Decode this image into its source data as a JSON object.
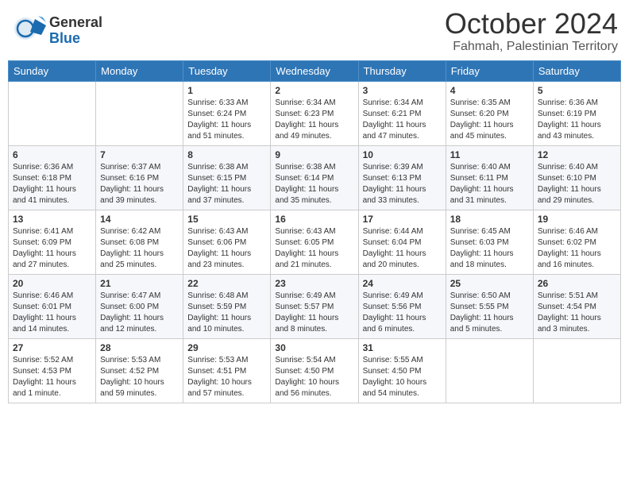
{
  "logo": {
    "general": "General",
    "blue": "Blue"
  },
  "header": {
    "month": "October 2024",
    "subtitle": "Fahmah, Palestinian Territory"
  },
  "days": [
    "Sunday",
    "Monday",
    "Tuesday",
    "Wednesday",
    "Thursday",
    "Friday",
    "Saturday"
  ],
  "weeks": [
    [
      {
        "day": "",
        "sunrise": "",
        "sunset": "",
        "daylight": ""
      },
      {
        "day": "",
        "sunrise": "",
        "sunset": "",
        "daylight": ""
      },
      {
        "day": "1",
        "sunrise": "Sunrise: 6:33 AM",
        "sunset": "Sunset: 6:24 PM",
        "daylight": "Daylight: 11 hours and 51 minutes."
      },
      {
        "day": "2",
        "sunrise": "Sunrise: 6:34 AM",
        "sunset": "Sunset: 6:23 PM",
        "daylight": "Daylight: 11 hours and 49 minutes."
      },
      {
        "day": "3",
        "sunrise": "Sunrise: 6:34 AM",
        "sunset": "Sunset: 6:21 PM",
        "daylight": "Daylight: 11 hours and 47 minutes."
      },
      {
        "day": "4",
        "sunrise": "Sunrise: 6:35 AM",
        "sunset": "Sunset: 6:20 PM",
        "daylight": "Daylight: 11 hours and 45 minutes."
      },
      {
        "day": "5",
        "sunrise": "Sunrise: 6:36 AM",
        "sunset": "Sunset: 6:19 PM",
        "daylight": "Daylight: 11 hours and 43 minutes."
      }
    ],
    [
      {
        "day": "6",
        "sunrise": "Sunrise: 6:36 AM",
        "sunset": "Sunset: 6:18 PM",
        "daylight": "Daylight: 11 hours and 41 minutes."
      },
      {
        "day": "7",
        "sunrise": "Sunrise: 6:37 AM",
        "sunset": "Sunset: 6:16 PM",
        "daylight": "Daylight: 11 hours and 39 minutes."
      },
      {
        "day": "8",
        "sunrise": "Sunrise: 6:38 AM",
        "sunset": "Sunset: 6:15 PM",
        "daylight": "Daylight: 11 hours and 37 minutes."
      },
      {
        "day": "9",
        "sunrise": "Sunrise: 6:38 AM",
        "sunset": "Sunset: 6:14 PM",
        "daylight": "Daylight: 11 hours and 35 minutes."
      },
      {
        "day": "10",
        "sunrise": "Sunrise: 6:39 AM",
        "sunset": "Sunset: 6:13 PM",
        "daylight": "Daylight: 11 hours and 33 minutes."
      },
      {
        "day": "11",
        "sunrise": "Sunrise: 6:40 AM",
        "sunset": "Sunset: 6:11 PM",
        "daylight": "Daylight: 11 hours and 31 minutes."
      },
      {
        "day": "12",
        "sunrise": "Sunrise: 6:40 AM",
        "sunset": "Sunset: 6:10 PM",
        "daylight": "Daylight: 11 hours and 29 minutes."
      }
    ],
    [
      {
        "day": "13",
        "sunrise": "Sunrise: 6:41 AM",
        "sunset": "Sunset: 6:09 PM",
        "daylight": "Daylight: 11 hours and 27 minutes."
      },
      {
        "day": "14",
        "sunrise": "Sunrise: 6:42 AM",
        "sunset": "Sunset: 6:08 PM",
        "daylight": "Daylight: 11 hours and 25 minutes."
      },
      {
        "day": "15",
        "sunrise": "Sunrise: 6:43 AM",
        "sunset": "Sunset: 6:06 PM",
        "daylight": "Daylight: 11 hours and 23 minutes."
      },
      {
        "day": "16",
        "sunrise": "Sunrise: 6:43 AM",
        "sunset": "Sunset: 6:05 PM",
        "daylight": "Daylight: 11 hours and 21 minutes."
      },
      {
        "day": "17",
        "sunrise": "Sunrise: 6:44 AM",
        "sunset": "Sunset: 6:04 PM",
        "daylight": "Daylight: 11 hours and 20 minutes."
      },
      {
        "day": "18",
        "sunrise": "Sunrise: 6:45 AM",
        "sunset": "Sunset: 6:03 PM",
        "daylight": "Daylight: 11 hours and 18 minutes."
      },
      {
        "day": "19",
        "sunrise": "Sunrise: 6:46 AM",
        "sunset": "Sunset: 6:02 PM",
        "daylight": "Daylight: 11 hours and 16 minutes."
      }
    ],
    [
      {
        "day": "20",
        "sunrise": "Sunrise: 6:46 AM",
        "sunset": "Sunset: 6:01 PM",
        "daylight": "Daylight: 11 hours and 14 minutes."
      },
      {
        "day": "21",
        "sunrise": "Sunrise: 6:47 AM",
        "sunset": "Sunset: 6:00 PM",
        "daylight": "Daylight: 11 hours and 12 minutes."
      },
      {
        "day": "22",
        "sunrise": "Sunrise: 6:48 AM",
        "sunset": "Sunset: 5:59 PM",
        "daylight": "Daylight: 11 hours and 10 minutes."
      },
      {
        "day": "23",
        "sunrise": "Sunrise: 6:49 AM",
        "sunset": "Sunset: 5:57 PM",
        "daylight": "Daylight: 11 hours and 8 minutes."
      },
      {
        "day": "24",
        "sunrise": "Sunrise: 6:49 AM",
        "sunset": "Sunset: 5:56 PM",
        "daylight": "Daylight: 11 hours and 6 minutes."
      },
      {
        "day": "25",
        "sunrise": "Sunrise: 6:50 AM",
        "sunset": "Sunset: 5:55 PM",
        "daylight": "Daylight: 11 hours and 5 minutes."
      },
      {
        "day": "26",
        "sunrise": "Sunrise: 5:51 AM",
        "sunset": "Sunset: 4:54 PM",
        "daylight": "Daylight: 11 hours and 3 minutes."
      }
    ],
    [
      {
        "day": "27",
        "sunrise": "Sunrise: 5:52 AM",
        "sunset": "Sunset: 4:53 PM",
        "daylight": "Daylight: 11 hours and 1 minute."
      },
      {
        "day": "28",
        "sunrise": "Sunrise: 5:53 AM",
        "sunset": "Sunset: 4:52 PM",
        "daylight": "Daylight: 10 hours and 59 minutes."
      },
      {
        "day": "29",
        "sunrise": "Sunrise: 5:53 AM",
        "sunset": "Sunset: 4:51 PM",
        "daylight": "Daylight: 10 hours and 57 minutes."
      },
      {
        "day": "30",
        "sunrise": "Sunrise: 5:54 AM",
        "sunset": "Sunset: 4:50 PM",
        "daylight": "Daylight: 10 hours and 56 minutes."
      },
      {
        "day": "31",
        "sunrise": "Sunrise: 5:55 AM",
        "sunset": "Sunset: 4:50 PM",
        "daylight": "Daylight: 10 hours and 54 minutes."
      },
      {
        "day": "",
        "sunrise": "",
        "sunset": "",
        "daylight": ""
      },
      {
        "day": "",
        "sunrise": "",
        "sunset": "",
        "daylight": ""
      }
    ]
  ]
}
